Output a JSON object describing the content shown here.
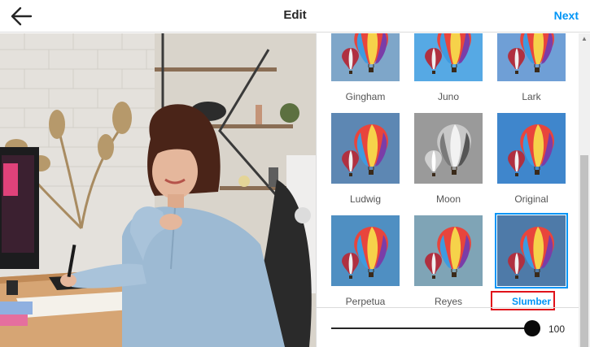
{
  "header": {
    "title": "Edit",
    "next_label": "Next",
    "back_icon": "arrow-left-icon"
  },
  "photo": {
    "description_icon": "photo-woman-at-desk"
  },
  "filters": {
    "items": [
      {
        "label": "Gingham",
        "tint": "#7ea6c9"
      },
      {
        "label": "Juno",
        "tint": "#56a9e4"
      },
      {
        "label": "Lark",
        "tint": "#6f9fd6"
      },
      {
        "label": "Ludwig",
        "tint": "#5d87b3"
      },
      {
        "label": "Moon",
        "tint": "#9a9a9a"
      },
      {
        "label": "Original",
        "tint": "#3f86cc"
      },
      {
        "label": "Perpetua",
        "tint": "#4f8fc2"
      },
      {
        "label": "Reyes",
        "tint": "#7fa4b6"
      },
      {
        "label": "Slumber",
        "tint": "#4e7aa8"
      }
    ],
    "selected": "Slumber"
  },
  "slider": {
    "value": "100",
    "level": 1.0
  }
}
